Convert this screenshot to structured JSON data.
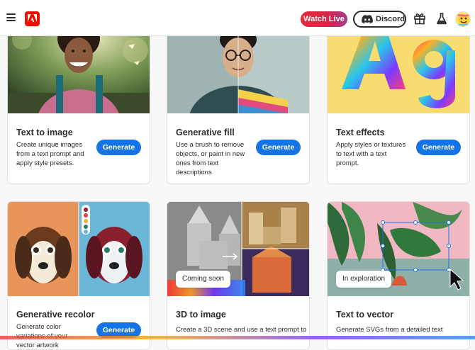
{
  "header": {
    "watch_live": "Watch Live",
    "discord": "Discord",
    "icons": [
      "menu-icon",
      "adobe-logo",
      "discord-icon",
      "gift-icon",
      "flask-icon",
      "avatar"
    ]
  },
  "colors": {
    "accent_blue": "#1473e6",
    "adobe_red": "#eb1000",
    "watch_live_start": "#e8293b",
    "watch_live_end": "#a23c8e"
  },
  "cards": [
    {
      "title": "Text to image",
      "description": "Create unique images from a text prompt and apply style presets.",
      "button": "Generate"
    },
    {
      "title": "Generative fill",
      "description": "Use a brush to remove objects, or paint in new ones from text descriptions",
      "button": "Generate"
    },
    {
      "title": "Text effects",
      "description": "Apply styles or textures to text with a text prompt.",
      "button": "Generate"
    },
    {
      "title": "Generative recolor",
      "description": "Generate color variations of your vector artwork",
      "button": "Generate"
    },
    {
      "title": "3D to image",
      "description": "Create a 3D scene and use a text prompt to",
      "badge": "Coming soon"
    },
    {
      "title": "Text to vector",
      "description": "Generate SVGs from a detailed text",
      "badge": "In exploration"
    }
  ]
}
